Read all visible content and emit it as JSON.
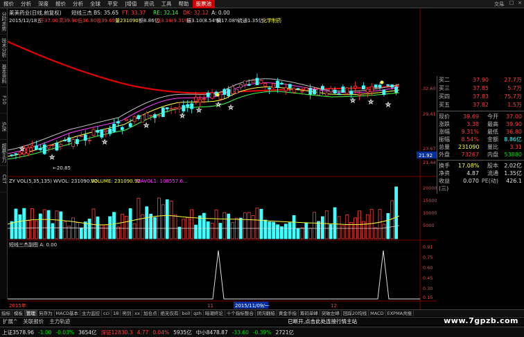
{
  "menu": {
    "items": [
      "报价",
      "分析",
      "深度",
      "报价",
      "分析",
      "全球",
      "平安",
      "|增值",
      "资讯",
      "工具",
      "帮助"
    ],
    "highlight": "股票池",
    "right_label": "交易"
  },
  "left_toolbar": [
    "分时走势",
    "技术分析",
    "基本资料",
    "F10",
    "沪深",
    "超赢主力",
    "CET"
  ],
  "header": {
    "stock": "莱美药业(日线,前复权)",
    "indicator": "短线三杰",
    "bs": "BS: 35.65",
    "ft": "FT: 33.37",
    "re": "RE: 32.14",
    "dk": "DK: 32.12",
    "a": "A: 0.00",
    "date_line": "2015/12/18五",
    "open": "开37.00",
    "high": "高39.90",
    "low": "低36.80",
    "close": "收39.69",
    "volume": "量231090",
    "amount": "额8.86亿",
    "change": "涨3.38(9.31%)",
    "amplitude": "振3.10(8.54%)",
    "turnover": "换17.08%",
    "float": "流通1.35亿",
    "industry": "化学制药"
  },
  "price_axis": [
    "32.60",
    "29.41",
    "23.67",
    "21.44"
  ],
  "price_marker": "21.92",
  "low_label": "←20.85",
  "volume_panel": {
    "header_name": "ZY VOL(5,35,135)",
    "wvol": "WVOL: 231090.92",
    "volume": "VOLUME: 231090.92",
    "mavol": "MAVOL1: 108557.6...",
    "axis": [
      "20000",
      "15000",
      "10000",
      "5000"
    ]
  },
  "lower_panel": {
    "header": "短线三杰副图 A: 0.00",
    "axis": [
      "0.91",
      "0.75",
      "0.60",
      "0.45",
      "0.30",
      "0.15"
    ]
  },
  "date_axis": {
    "start": "2015年",
    "mid": "11",
    "cursor": "2015/11/09/一",
    "right": "12"
  },
  "quotes": [
    {
      "label": "买二",
      "price": "37.90",
      "vol": "27.7万"
    },
    {
      "label": "买三",
      "price": "37.85",
      "vol": "5.7万"
    },
    {
      "label": "买四",
      "price": "37.83",
      "vol": "75.7万"
    },
    {
      "label": "买五",
      "price": "37.82",
      "vol": "1.5万"
    }
  ],
  "stats": [
    {
      "l1": "现价",
      "v1": "39.69",
      "c1": "red",
      "l2": "今开",
      "v2": "37.00",
      "c2": "red"
    },
    {
      "l1": "涨跌",
      "v1": "3.38",
      "c1": "red",
      "l2": "最高",
      "v2": "39.90",
      "c2": "red"
    },
    {
      "l1": "涨幅",
      "v1": "9.31%",
      "c1": "red",
      "l2": "最低",
      "v2": "36.80",
      "c2": "red"
    },
    {
      "l1": "振幅",
      "v1": "8.54%",
      "c1": "red",
      "l2": "金额",
      "v2": "8.86亿",
      "c2": "cyn"
    },
    {
      "l1": "总量",
      "v1": "231090",
      "c1": "yel",
      "l2": "量比",
      "v2": "3.31",
      "c2": "red"
    },
    {
      "l1": "外盘",
      "v1": "73267",
      "c1": "red",
      "l2": "内盘",
      "v2": "53880",
      "c2": "grn"
    },
    {
      "l1": "换手",
      "v1": "17.08%",
      "c1": "yel",
      "l2": "股本",
      "v2": "2.02亿",
      "c2": "wht"
    },
    {
      "l1": "净资",
      "v1": "4.87",
      "c1": "wht",
      "l2": "流通",
      "v2": "1.35亿",
      "c2": "wht"
    },
    {
      "l1": "收益(三)",
      "v1": "0.070",
      "c1": "wht",
      "l2": "PE(动)",
      "v2": "426.1",
      "c2": "wht"
    }
  ],
  "tabs": [
    "指标",
    "模板",
    "管理",
    "另存为",
    "MACD基本",
    "主力监控",
    "cci",
    "18",
    "亮剑",
    "xx",
    "加仓点",
    "绝无仅有",
    "boll",
    "qzh",
    "暗潮终论",
    "十个指标整合",
    "阴沟翻船",
    "黄金手指",
    "筹码单峰",
    "突破左峰",
    "回踩20均线",
    "MACD",
    "EXPMA共振"
  ],
  "subbar": {
    "items": [
      "扩展^",
      "关联报价",
      "主力轨迹"
    ],
    "notice": "已断开,点击此处连接行情主站"
  },
  "watermark": "www.7gpzb.com",
  "status": [
    {
      "t": "上证3578.96",
      "c": "wht"
    },
    {
      "t": "-1.00",
      "c": "grn"
    },
    {
      "t": "-0.03%",
      "c": "grn"
    },
    {
      "t": "3654亿",
      "c": "wht"
    },
    {
      "t": "深证12830.3",
      "c": "red"
    },
    {
      "t": "4.77",
      "c": "red"
    },
    {
      "t": "0.04%",
      "c": "red"
    },
    {
      "t": "5935亿",
      "c": "wht"
    },
    {
      "t": "中小8478.87",
      "c": "wht"
    },
    {
      "t": "-33.60",
      "c": "grn"
    },
    {
      "t": "-0.39%",
      "c": "grn"
    },
    {
      "t": "2721亿",
      "c": "wht"
    }
  ],
  "colors": {
    "up": "#ff4040",
    "down": "#40ffff",
    "ma_long": "#e00000",
    "bg": "#000000"
  }
}
